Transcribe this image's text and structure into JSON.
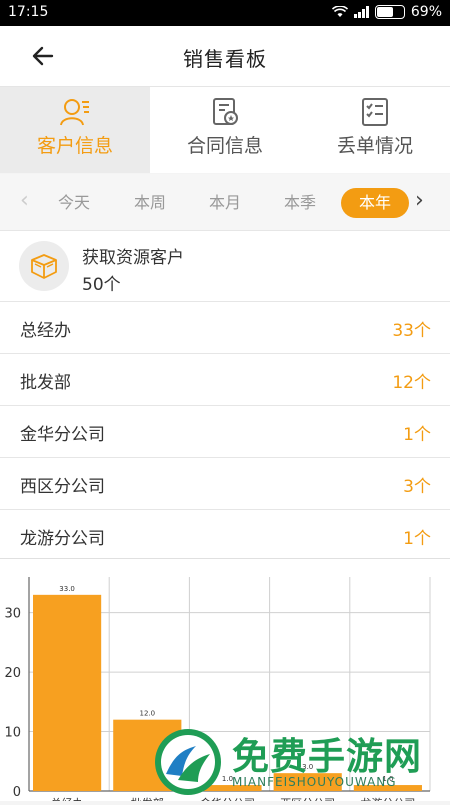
{
  "status_bar": {
    "time": "17:15",
    "battery": "69%",
    "battery_level": 0.69
  },
  "header": {
    "title": "销售看板",
    "back_icon": "arrow-left-icon"
  },
  "tabs": [
    {
      "label": "客户信息",
      "icon": "customer-icon",
      "active": true
    },
    {
      "label": "合同信息",
      "icon": "contract-icon",
      "active": false
    },
    {
      "label": "丢单情况",
      "icon": "checklist-icon",
      "active": false
    }
  ],
  "ranges": [
    "今天",
    "本周",
    "本月",
    "本季",
    "本年"
  ],
  "selected_range": "本年",
  "summary": {
    "title": "获取资源客户",
    "count": "50个",
    "icon": "box-icon"
  },
  "departments": [
    {
      "name": "总经办",
      "count": "33个"
    },
    {
      "name": "批发部",
      "count": "12个"
    },
    {
      "name": "金华分公司",
      "count": "1个"
    },
    {
      "name": "西区分公司",
      "count": "3个"
    },
    {
      "name": "龙游分公司",
      "count": "1个"
    }
  ],
  "chart_data": {
    "type": "bar",
    "categories": [
      "总经办",
      "批发部",
      "金华分公司",
      "西区分公司",
      "龙游分公司"
    ],
    "values": [
      33.0,
      12.0,
      1.0,
      3.0,
      1.0
    ],
    "value_labels": [
      "33.0",
      "12.0",
      "1.0",
      "3.0",
      "1.0"
    ],
    "ylim": [
      0,
      36
    ],
    "yticks": [
      0,
      10,
      20,
      30
    ],
    "grid": true,
    "bar_color": "#f7a020"
  },
  "watermark": {
    "text": "免费手游网",
    "sub": "MIANFEISHOUYOUWANG"
  },
  "colors": {
    "accent": "#f39c12"
  }
}
